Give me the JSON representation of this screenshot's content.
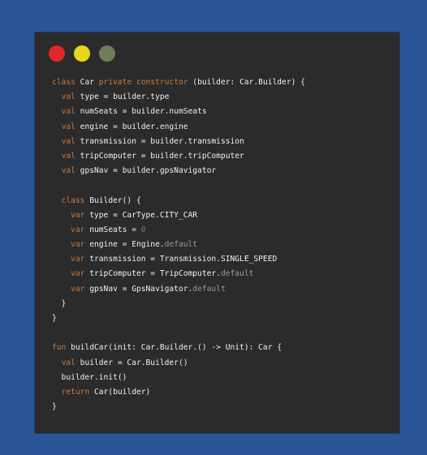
{
  "window": {
    "traffic_lights": [
      {
        "name": "close",
        "color": "#e2272a"
      },
      {
        "name": "minimize",
        "color": "#e6d61b"
      },
      {
        "name": "maximize",
        "color": "#6e7d5c"
      }
    ]
  },
  "code": {
    "lines": [
      [
        {
          "t": "class",
          "c": "kw"
        },
        {
          "t": " Car "
        },
        {
          "t": "private constructor",
          "c": "kw"
        },
        {
          "t": " (builder: Car.Builder) {"
        }
      ],
      [
        {
          "t": "  "
        },
        {
          "t": "val",
          "c": "kw"
        },
        {
          "t": " type = builder.type"
        }
      ],
      [
        {
          "t": "  "
        },
        {
          "t": "val",
          "c": "kw"
        },
        {
          "t": " numSeats = builder.numSeats"
        }
      ],
      [
        {
          "t": "  "
        },
        {
          "t": "val",
          "c": "kw"
        },
        {
          "t": " engine = builder.engine"
        }
      ],
      [
        {
          "t": "  "
        },
        {
          "t": "val",
          "c": "kw"
        },
        {
          "t": " transmission = builder.transmission"
        }
      ],
      [
        {
          "t": "  "
        },
        {
          "t": "val",
          "c": "kw"
        },
        {
          "t": " tripComputer = builder.tripComputer"
        }
      ],
      [
        {
          "t": "  "
        },
        {
          "t": "val",
          "c": "kw"
        },
        {
          "t": " gpsNav = builder.gpsNavigator"
        }
      ],
      [],
      [
        {
          "t": "  "
        },
        {
          "t": "class",
          "c": "kw"
        },
        {
          "t": " Builder() {"
        }
      ],
      [
        {
          "t": "    "
        },
        {
          "t": "var",
          "c": "kw"
        },
        {
          "t": " type = CarType.CITY_CAR"
        }
      ],
      [
        {
          "t": "    "
        },
        {
          "t": "var",
          "c": "kw"
        },
        {
          "t": " numSeats = "
        },
        {
          "t": "0",
          "c": "num"
        }
      ],
      [
        {
          "t": "    "
        },
        {
          "t": "var",
          "c": "kw"
        },
        {
          "t": " engine = Engine."
        },
        {
          "t": "default",
          "c": "dim"
        }
      ],
      [
        {
          "t": "    "
        },
        {
          "t": "var",
          "c": "kw"
        },
        {
          "t": " transmission = Transmission.SINGLE_SPEED"
        }
      ],
      [
        {
          "t": "    "
        },
        {
          "t": "var",
          "c": "kw"
        },
        {
          "t": " tripComputer = TripComputer."
        },
        {
          "t": "default",
          "c": "dim"
        }
      ],
      [
        {
          "t": "    "
        },
        {
          "t": "var",
          "c": "kw"
        },
        {
          "t": " gpsNav = GpsNavigator."
        },
        {
          "t": "default",
          "c": "dim"
        }
      ],
      [
        {
          "t": "  }"
        }
      ],
      [
        {
          "t": "}"
        }
      ],
      [],
      [
        {
          "t": "fun",
          "c": "kw"
        },
        {
          "t": " buildCar(init: Car.Builder.() -> Unit): Car {"
        }
      ],
      [
        {
          "t": "  "
        },
        {
          "t": "val",
          "c": "kw"
        },
        {
          "t": " builder = Car.Builder()"
        }
      ],
      [
        {
          "t": "  builder.init()"
        }
      ],
      [
        {
          "t": "  "
        },
        {
          "t": "return",
          "c": "kw"
        },
        {
          "t": " Car(builder)"
        }
      ],
      [
        {
          "t": "}"
        }
      ]
    ]
  }
}
